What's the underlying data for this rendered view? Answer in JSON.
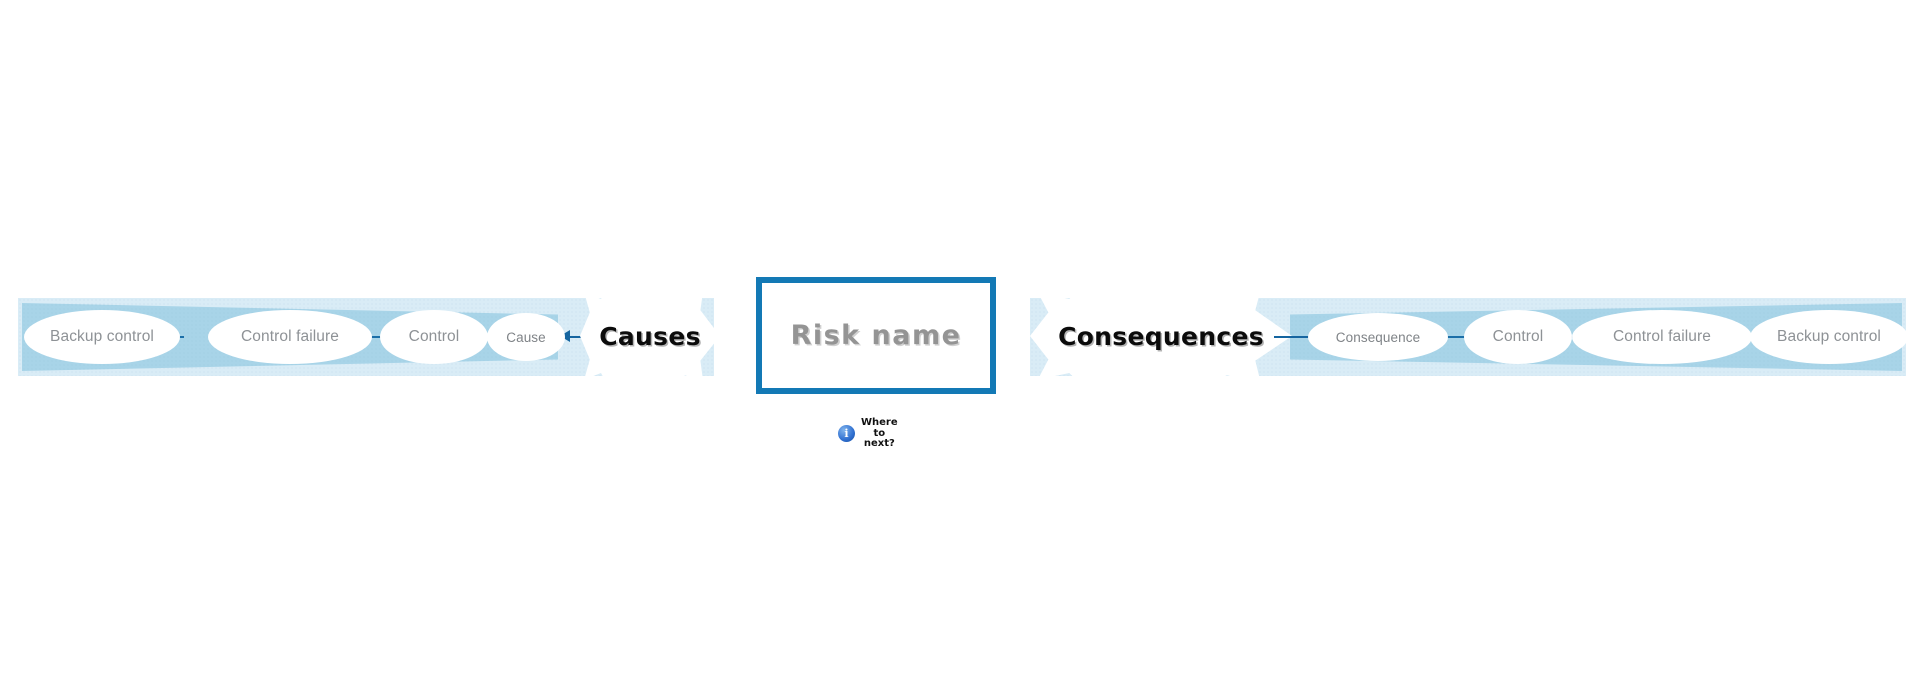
{
  "diagram": {
    "type": "bowtie-risk-diagram",
    "colors": {
      "band_outer": "#d9ecf6",
      "band_inner": "#a8d4e8",
      "connector": "#1c6fa8",
      "arrow": "#1565a0",
      "risk_box_border": "#1379b5",
      "risk_name_text": "#949494",
      "node_text": "#8e9296",
      "starburst_fill": "#ffffff",
      "starburst_text": "#0b0b0b",
      "info_icon": "#2f6fd0"
    }
  },
  "causes_side": {
    "starburst_label": "Causes",
    "nodes": [
      {
        "label": "Backup control",
        "kind": "backup-control"
      },
      {
        "label": "Control failure",
        "kind": "control-failure"
      },
      {
        "label": "Control",
        "kind": "control"
      },
      {
        "label": "Cause",
        "kind": "cause"
      }
    ]
  },
  "risk": {
    "name": "Risk name"
  },
  "consequences_side": {
    "starburst_label": "Consequences",
    "nodes": [
      {
        "label": "Consequence",
        "kind": "consequence"
      },
      {
        "label": "Control",
        "kind": "control"
      },
      {
        "label": "Control failure",
        "kind": "control-failure"
      },
      {
        "label": "Backup control",
        "kind": "backup-control"
      }
    ]
  },
  "helper": {
    "icon": "info-icon",
    "icon_glyph": "i",
    "label": "Where\nto\nnext?"
  }
}
